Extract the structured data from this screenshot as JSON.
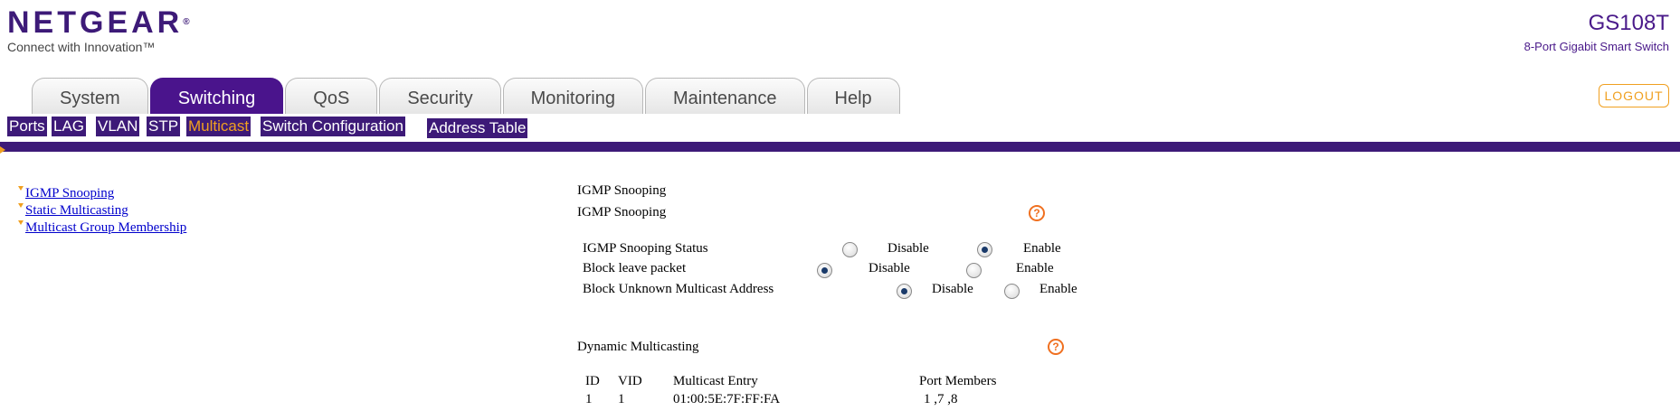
{
  "header": {
    "brand": "NETGEAR",
    "brand_mark": "®",
    "tagline": "Connect with Innovation™",
    "model": "GS108T",
    "model_desc": "8-Port Gigabit Smart Switch",
    "logout_label": "LOGOUT"
  },
  "tabs": [
    {
      "label": "System",
      "active": false
    },
    {
      "label": "Switching",
      "active": true
    },
    {
      "label": "QoS",
      "active": false
    },
    {
      "label": "Security",
      "active": false
    },
    {
      "label": "Monitoring",
      "active": false
    },
    {
      "label": "Maintenance",
      "active": false
    },
    {
      "label": "Help",
      "active": false
    }
  ],
  "subnav": [
    {
      "label": "Ports"
    },
    {
      "label": "LAG"
    },
    {
      "label": "VLAN"
    },
    {
      "label": "STP"
    },
    {
      "label": "Multicast",
      "active": true
    },
    {
      "label": "Switch Configuration"
    },
    {
      "label": "Address Table"
    }
  ],
  "leftnav": [
    {
      "label": "IGMP Snooping"
    },
    {
      "label": "Static Multicasting"
    },
    {
      "label": "Multicast Group Membership"
    }
  ],
  "content": {
    "page_title": "IGMP Snooping",
    "section_igmp": "IGMP Snooping",
    "help_glyph": "?",
    "settings": [
      {
        "label": "IGMP Snooping Status",
        "disable_label": "Disable",
        "enable_label": "Enable",
        "selected": "Enable"
      },
      {
        "label": "Block leave packet",
        "disable_label": "Disable",
        "enable_label": "Enable",
        "selected": "Disable"
      },
      {
        "label": "Block Unknown Multicast Address",
        "disable_label": "Disable",
        "enable_label": "Enable",
        "selected": "Disable"
      }
    ],
    "section_dynamic": "Dynamic Multicasting",
    "table": {
      "headers": [
        "ID",
        "VID",
        "Multicast Entry",
        "Port Members"
      ],
      "rows": [
        [
          "1",
          "1",
          "01:00:5E:7F:FF:FA",
          "1 ,7 ,8"
        ]
      ]
    }
  },
  "colors": {
    "brand_purple": "#3d1a78",
    "tab_active": "#4a148c",
    "accent_orange": "#f0a020",
    "link_blue": "#0000cc"
  },
  "icons": {
    "help": "help-icon",
    "nav_arrow": "arrow-icon"
  }
}
